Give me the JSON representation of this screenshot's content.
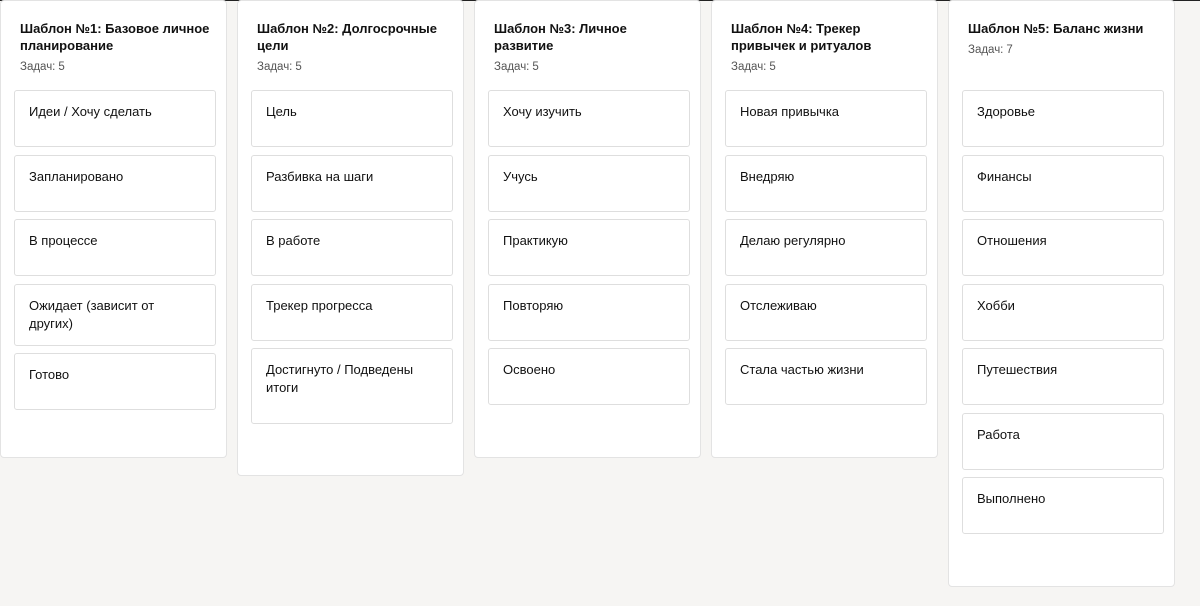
{
  "columns": [
    {
      "title": "Шаблон №1: Базовое личное планирование",
      "count_label": "Задач:",
      "count": "5",
      "cards": [
        "Идеи / Хочу сделать",
        "Запланировано",
        "В процессе",
        "Ожидает (зависит от других)",
        "Готово"
      ]
    },
    {
      "title": "Шаблон №2: Долгосрочные цели",
      "count_label": "Задач:",
      "count": "5",
      "cards": [
        "Цель",
        "Разбивка на шаги",
        "В работе",
        "Трекер прогресса",
        "Достигнуто / Подведены итоги"
      ]
    },
    {
      "title": "Шаблон №3: Личное развитие",
      "count_label": "Задач:",
      "count": "5",
      "cards": [
        "Хочу изучить",
        "Учусь",
        "Практикую",
        "Повторяю",
        "Освоено"
      ]
    },
    {
      "title": "Шаблон №4: Трекер привычек и ритуалов",
      "count_label": "Задач:",
      "count": "5",
      "cards": [
        "Новая привычка",
        "Внедряю",
        "Делаю регулярно",
        "Отслеживаю",
        "Стала частью жизни"
      ]
    },
    {
      "title": "Шаблон №5: Баланс жизни",
      "count_label": "Задач:",
      "count": "7",
      "cards": [
        "Здоровье",
        "Финансы",
        "Отношения",
        "Хобби",
        "Путешествия",
        "Работа",
        "Выполнено"
      ]
    }
  ]
}
